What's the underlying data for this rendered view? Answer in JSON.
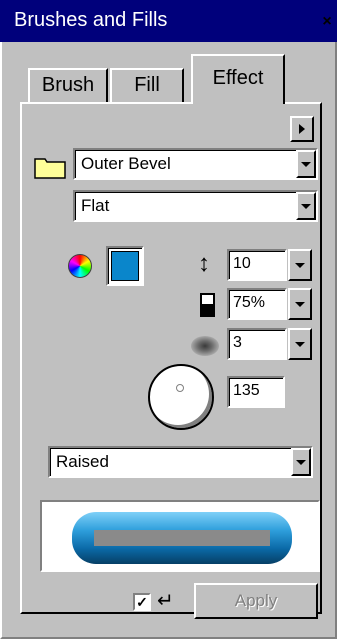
{
  "window": {
    "title": "Brushes and Fills",
    "close_glyph": "×"
  },
  "tabs": [
    {
      "label": "Brush",
      "selected": false
    },
    {
      "label": "Fill",
      "selected": false
    },
    {
      "label": "Effect",
      "selected": true
    }
  ],
  "effect": {
    "type_value": "Outer Bevel",
    "edge_value": "Flat",
    "color": "#0a86cb",
    "height_value": "10",
    "opacity_value": "75%",
    "softness_value": "3",
    "angle_value": "135",
    "style_value": "Raised",
    "auto_apply_checked": true,
    "auto_apply_glyph": "✓",
    "enter_glyph": "↵",
    "apply_label": "Apply"
  },
  "icons": {
    "menu": "arrow-right-icon",
    "folder": "folder-icon",
    "color": "color-wheel-icon",
    "height": "up-down-arrow-icon",
    "opacity": "opacity-icon",
    "softness": "blur-icon",
    "angle": "angle-dial-icon"
  }
}
